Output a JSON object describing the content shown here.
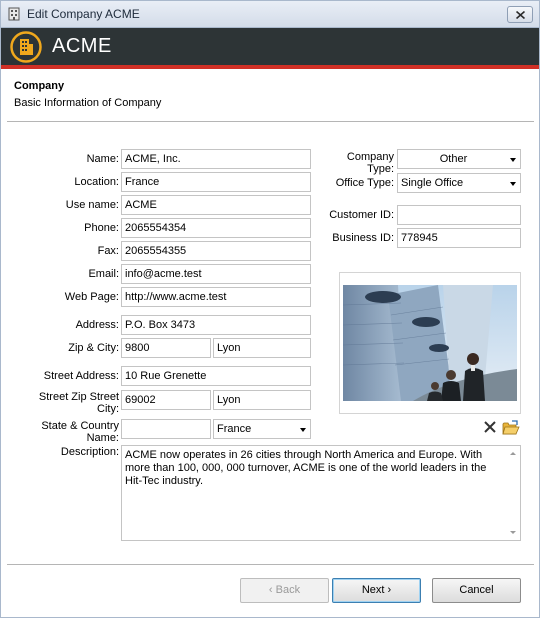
{
  "window": {
    "title": "Edit Company ACME",
    "close_icon": "close-icon"
  },
  "banner": {
    "title": "ACME",
    "icon": "building-icon",
    "stripe_color": "#d03026",
    "background": "#2d3436"
  },
  "section": {
    "title": "Company",
    "subtitle": "Basic Information of Company"
  },
  "form": {
    "name": {
      "label": "Name:",
      "value": "ACME, Inc."
    },
    "location": {
      "label": "Location:",
      "value": "France"
    },
    "use_name": {
      "label": "Use name:",
      "value": "ACME"
    },
    "phone": {
      "label": "Phone:",
      "value": "2065554354"
    },
    "fax": {
      "label": "Fax:",
      "value": "2065554355"
    },
    "email": {
      "label": "Email:",
      "value": "info@acme.test"
    },
    "web_page": {
      "label": "Web Page:",
      "value": "http://www.acme.test"
    },
    "address": {
      "label": "Address:",
      "value": "P.O. Box 3473"
    },
    "zip_city": {
      "label": "Zip & City:",
      "zip": "9800",
      "city": "Lyon"
    },
    "street_address": {
      "label": "Street Address:",
      "value": "10 Rue Grenette"
    },
    "street_zip_city": {
      "label_line1": "Street Zip Street",
      "label_line2": "City:",
      "zip": "69002",
      "city": "Lyon"
    },
    "state_country": {
      "label_line1": "State & Country",
      "label_line2": "Name:",
      "state": "",
      "country": "France"
    },
    "description": {
      "label": "Description:",
      "value": "ACME now operates in 26 cities through North America and Europe. With more than 100, 000, 000 turnover, ACME is one of the world leaders in the Hit-Tec industry."
    },
    "company_type": {
      "label_line1": "Company",
      "label_line2": "Type:",
      "value": "Other"
    },
    "office_type": {
      "label": "Office Type:",
      "value": "Single Office"
    },
    "customer_id": {
      "label": "Customer ID:",
      "value": ""
    },
    "business_id": {
      "label": "Business ID:",
      "value": "778945"
    }
  },
  "photo": {
    "delete_icon": "delete-x-icon",
    "open_icon": "folder-open-icon"
  },
  "buttons": {
    "back": "‹ Back",
    "next": "Next ›",
    "cancel": "Cancel"
  }
}
